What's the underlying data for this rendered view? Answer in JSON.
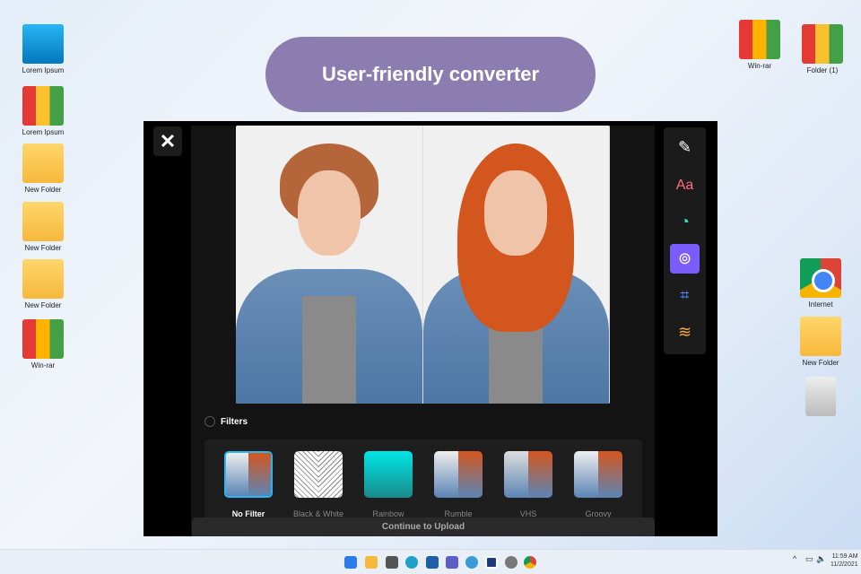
{
  "desktop_left": [
    {
      "label": "Lorem Ipsum",
      "icon": "computer-icon"
    },
    {
      "label": "Lorem Ipsum",
      "icon": "binders-icon"
    },
    {
      "label": "New Folder",
      "icon": "folder-icon"
    },
    {
      "label": "New Folder",
      "icon": "folder-icon"
    },
    {
      "label": "New Folder",
      "icon": "folder-icon"
    },
    {
      "label": "Win-rar",
      "icon": "winrar-icon"
    }
  ],
  "desktop_right": [
    {
      "label": "Win-rar"
    },
    {
      "label": "Folder (1)"
    },
    {
      "label": "Internet"
    },
    {
      "label": "New Folder"
    }
  ],
  "banner": "User-friendly converter",
  "editor": {
    "close": "✕",
    "tools": {
      "text": "Aa"
    },
    "filters_label": "Filters",
    "filters": [
      {
        "name": "No Filter",
        "selected": true
      },
      {
        "name": "Black & White"
      },
      {
        "name": "Rainbow"
      },
      {
        "name": "Rumble"
      },
      {
        "name": "VHS"
      },
      {
        "name": "Groovy"
      }
    ],
    "continue": "Continue to Upload"
  },
  "taskbar": {
    "time": "11:59 AM",
    "date": "11/2/2021"
  },
  "colors": {
    "accent": "#7b5cff",
    "selected": "#29b6f6",
    "banner": "#8c7db0"
  }
}
